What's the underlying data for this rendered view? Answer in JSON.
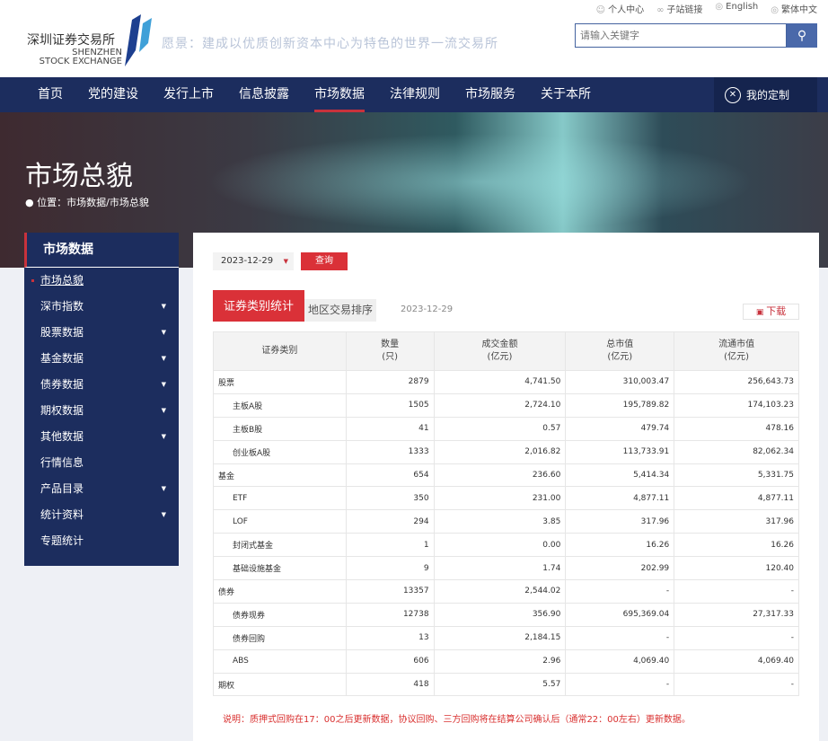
{
  "header": {
    "logo_cn": "深圳证券交易所",
    "logo_en1": "SHENZHEN",
    "logo_en2": "STOCK EXCHANGE",
    "slogan": "愿景：建成以优质创新资本中心为特色的世界一流交易所",
    "toplinks": [
      {
        "icon": "user-icon",
        "label": "个人中心"
      },
      {
        "icon": "link-icon",
        "label": "子站链接"
      },
      {
        "icon": "globe-icon",
        "label": "English"
      },
      {
        "icon": "globe-icon",
        "label": "繁体中文"
      }
    ],
    "search_placeholder": "请输入关键字"
  },
  "nav": {
    "items": [
      "首页",
      "党的建设",
      "发行上市",
      "信息披露",
      "市场数据",
      "法律规则",
      "市场服务",
      "关于本所"
    ],
    "active": 4,
    "custom": "我的定制"
  },
  "banner": {
    "title": "市场总貌",
    "location": "位置：市场数据/市场总貌"
  },
  "sidebar": {
    "title": "市场数据",
    "items": [
      {
        "label": "市场总貌",
        "active": true,
        "sub": false
      },
      {
        "label": "深市指数",
        "sub": true
      },
      {
        "label": "股票数据",
        "sub": true
      },
      {
        "label": "基金数据",
        "sub": true
      },
      {
        "label": "债券数据",
        "sub": true
      },
      {
        "label": "期权数据",
        "sub": true
      },
      {
        "label": "其他数据",
        "sub": true
      },
      {
        "label": "行情信息",
        "sub": false
      },
      {
        "label": "产品目录",
        "sub": true
      },
      {
        "label": "统计资料",
        "sub": true
      },
      {
        "label": "专题统计",
        "sub": false
      }
    ]
  },
  "main": {
    "date": "2023-12-29",
    "query": "查询",
    "tabs": [
      "证券类别统计",
      "地区交易排序"
    ],
    "table_date": "2023-12-29",
    "download": "下载",
    "headers": [
      [
        "证券类别"
      ],
      [
        "数量",
        "(只)"
      ],
      [
        "成交金额",
        "(亿元)"
      ],
      [
        "总市值",
        "(亿元)"
      ],
      [
        "流通市值",
        "(亿元)"
      ]
    ],
    "rows": [
      {
        "name": "股票",
        "sub": false,
        "v": [
          "2879",
          "4,741.50",
          "310,003.47",
          "256,643.73"
        ]
      },
      {
        "name": "主板A股",
        "sub": true,
        "v": [
          "1505",
          "2,724.10",
          "195,789.82",
          "174,103.23"
        ]
      },
      {
        "name": "主板B股",
        "sub": true,
        "v": [
          "41",
          "0.57",
          "479.74",
          "478.16"
        ]
      },
      {
        "name": "创业板A股",
        "sub": true,
        "v": [
          "1333",
          "2,016.82",
          "113,733.91",
          "82,062.34"
        ]
      },
      {
        "name": "基金",
        "sub": false,
        "v": [
          "654",
          "236.60",
          "5,414.34",
          "5,331.75"
        ]
      },
      {
        "name": "ETF",
        "sub": true,
        "v": [
          "350",
          "231.00",
          "4,877.11",
          "4,877.11"
        ]
      },
      {
        "name": "LOF",
        "sub": true,
        "v": [
          "294",
          "3.85",
          "317.96",
          "317.96"
        ]
      },
      {
        "name": "封闭式基金",
        "sub": true,
        "v": [
          "1",
          "0.00",
          "16.26",
          "16.26"
        ]
      },
      {
        "name": "基础设施基金",
        "sub": true,
        "v": [
          "9",
          "1.74",
          "202.99",
          "120.40"
        ]
      },
      {
        "name": "债券",
        "sub": false,
        "v": [
          "13357",
          "2,544.02",
          "-",
          "-"
        ]
      },
      {
        "name": "债券现券",
        "sub": true,
        "v": [
          "12738",
          "356.90",
          "695,369.04",
          "27,317.33"
        ]
      },
      {
        "name": "债券回购",
        "sub": true,
        "v": [
          "13",
          "2,184.15",
          "-",
          "-"
        ]
      },
      {
        "name": "ABS",
        "sub": true,
        "v": [
          "606",
          "2.96",
          "4,069.40",
          "4,069.40"
        ]
      },
      {
        "name": "期权",
        "sub": false,
        "v": [
          "418",
          "5.57",
          "-",
          "-"
        ]
      }
    ],
    "note": "说明：质押式回购在17：00之后更新数据，协议回购、三方回购将在结算公司确认后（通常22：00左右）更新数据。"
  }
}
